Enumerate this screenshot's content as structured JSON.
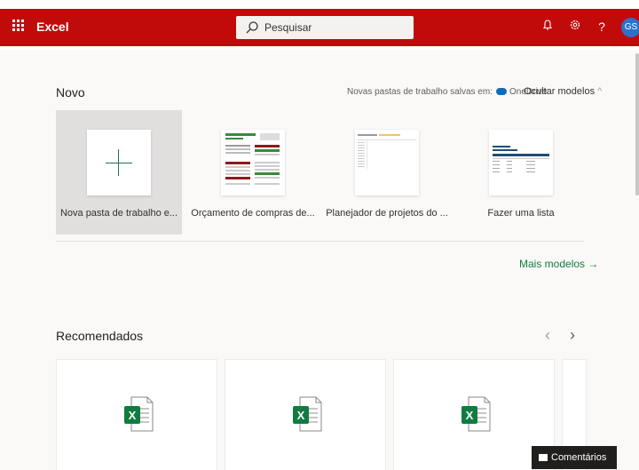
{
  "header": {
    "app_name": "Excel",
    "search_placeholder": "Pesquisar",
    "help_label": "?",
    "avatar_initials": "GS"
  },
  "novo": {
    "title": "Novo",
    "save_note": "Novas pastas de trabalho salvas em:",
    "save_location": "OneDrive",
    "hide_templates": "Ocultar modelos",
    "templates": [
      {
        "label": "Nova pasta de trabalho e..."
      },
      {
        "label": "Orçamento de compras de..."
      },
      {
        "label": "Planejador de projetos do ..."
      },
      {
        "label": "Fazer uma lista"
      }
    ],
    "more_templates": "Mais modelos",
    "more_arrow": "→"
  },
  "recomendados": {
    "title": "Recomendados",
    "prev": "‹",
    "next": "›"
  },
  "feedback": {
    "label": "Comentários"
  },
  "colors": {
    "brand_red": "#c10b0b",
    "excel_green": "#107c41",
    "avatar_blue": "#2c72c8"
  }
}
